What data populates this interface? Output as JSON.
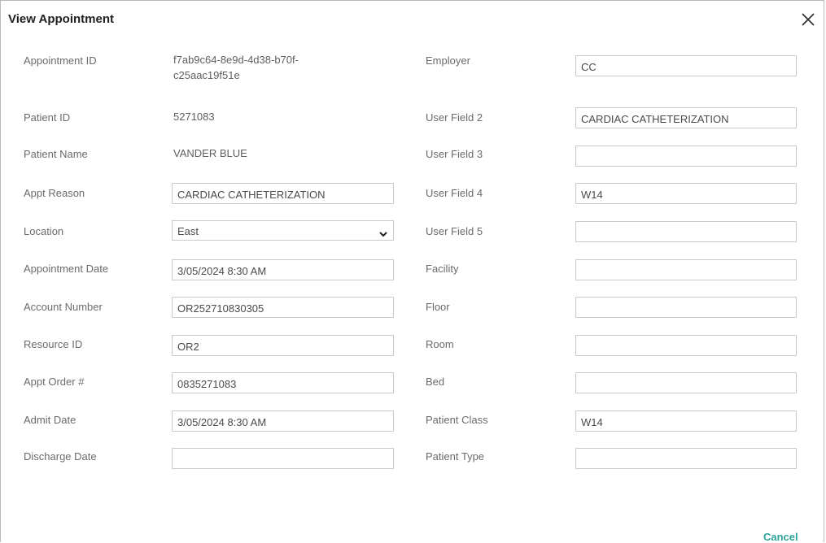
{
  "dialog": {
    "title": "View Appointment",
    "close_icon": "close-icon",
    "cancel_label": "Cancel",
    "accent_color": "#2aa29a"
  },
  "left": {
    "appointment_id": {
      "label": "Appointment ID",
      "value_line1": "f7ab9c64-8e9d-4d38-b70f-",
      "value_line2": "c25aac19f51e"
    },
    "patient_id": {
      "label": "Patient ID",
      "value": "5271083"
    },
    "patient_name": {
      "label": "Patient Name",
      "value": "VANDER BLUE"
    },
    "appt_reason": {
      "label": "Appt Reason",
      "value": "CARDIAC CATHETERIZATION"
    },
    "location": {
      "label": "Location",
      "value": "East"
    },
    "appointment_date": {
      "label": "Appointment Date",
      "value": "3/05/2024 8:30 AM"
    },
    "account_number": {
      "label": "Account Number",
      "value": "OR252710830305"
    },
    "resource_id": {
      "label": "Resource ID",
      "value": "OR2"
    },
    "appt_order": {
      "label": "Appt Order #",
      "value": "0835271083"
    },
    "admit_date": {
      "label": "Admit Date",
      "value": "3/05/2024 8:30 AM"
    },
    "discharge_date": {
      "label": "Discharge Date",
      "value": ""
    }
  },
  "right": {
    "employer": {
      "label": "Employer",
      "value": "CC"
    },
    "user_field_2": {
      "label": "User Field 2",
      "value": "CARDIAC CATHETERIZATION"
    },
    "user_field_3": {
      "label": "User Field 3",
      "value": ""
    },
    "user_field_4": {
      "label": "User Field 4",
      "value": "W14"
    },
    "user_field_5": {
      "label": "User Field 5",
      "value": ""
    },
    "facility": {
      "label": "Facility",
      "value": ""
    },
    "floor": {
      "label": "Floor",
      "value": ""
    },
    "room": {
      "label": "Room",
      "value": ""
    },
    "bed": {
      "label": "Bed",
      "value": ""
    },
    "patient_class": {
      "label": "Patient Class",
      "value": "W14"
    },
    "patient_type": {
      "label": "Patient Type",
      "value": ""
    }
  }
}
